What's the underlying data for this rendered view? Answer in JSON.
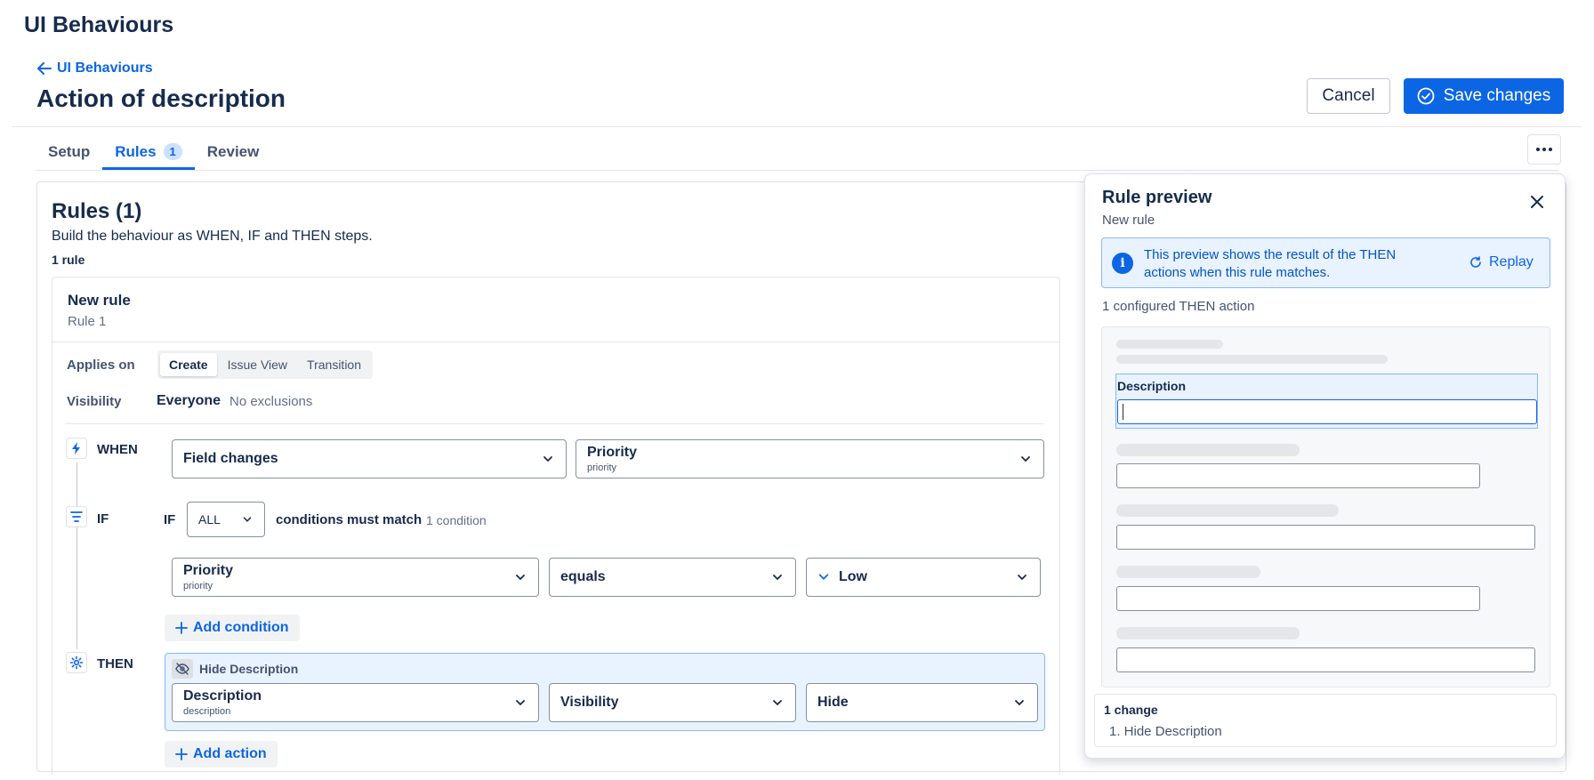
{
  "app": {
    "title": "UI Behaviours"
  },
  "breadcrumb": {
    "back_label": "UI Behaviours"
  },
  "page": {
    "title": "Action of description"
  },
  "actions": {
    "cancel_label": "Cancel",
    "save_label": "Save changes"
  },
  "tabs": [
    {
      "label": "Setup",
      "active": false
    },
    {
      "label": "Rules",
      "count": "1",
      "active": true
    },
    {
      "label": "Review",
      "active": false
    }
  ],
  "rules": {
    "title": "Rules (1)",
    "subtitle": "Build the behaviour as WHEN, IF and THEN steps.",
    "count_label": "1 rule"
  },
  "rule": {
    "name": "New rule",
    "number": "Rule 1",
    "applies_on_label": "Applies on",
    "applies_on_options": [
      "Create",
      "Issue View",
      "Transition"
    ],
    "applies_on_selected": "Create",
    "visibility_label": "Visibility",
    "visibility_value": "Everyone",
    "visibility_exclusions": "No exclusions"
  },
  "when": {
    "label": "WHEN",
    "trigger": "Field changes",
    "field": {
      "name": "Priority",
      "key": "priority"
    }
  },
  "if": {
    "label": "IF",
    "prefix": "IF",
    "match_mode": "ALL",
    "match_text": "conditions must match",
    "condition_count": "1 condition",
    "condition": {
      "field": {
        "name": "Priority",
        "key": "priority"
      },
      "operator": "equals",
      "value": "Low"
    },
    "add_label": "Add condition"
  },
  "then": {
    "label": "THEN",
    "action_title": "Hide Description",
    "action": {
      "field": {
        "name": "Description",
        "key": "description"
      },
      "property": "Visibility",
      "value": "Hide"
    },
    "add_label": "Add action"
  },
  "preview": {
    "title": "Rule preview",
    "subtitle": "New rule",
    "info_text": "This preview shows the result of the THEN actions when this rule matches.",
    "replay_label": "Replay",
    "configured": "1 configured THEN action",
    "field_label": "Description",
    "changes_title": "1 change",
    "changes_items": [
      "1. Hide Description"
    ]
  },
  "colors": {
    "accent": "#0c66e4",
    "accent_light": "#e9f2ff",
    "text": "#172b4d"
  },
  "icons": {
    "back": "arrow-left-icon",
    "save": "check-circle-icon",
    "more": "more-horizontal-icon",
    "when": "lightning-icon",
    "if": "filter-icon",
    "then": "gear-icon",
    "hide": "eye-off-icon",
    "info": "info-icon",
    "replay": "refresh-icon",
    "close": "close-icon"
  }
}
